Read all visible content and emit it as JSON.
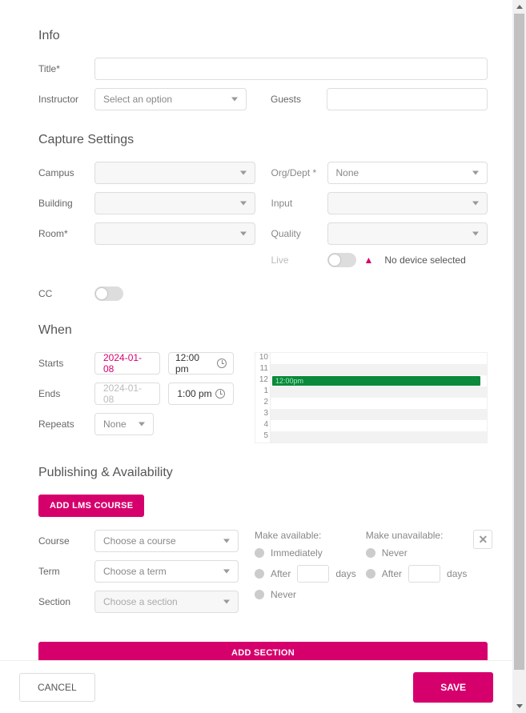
{
  "info": {
    "heading": "Info",
    "title_label": "Title*",
    "instructor_label": "Instructor",
    "instructor_placeholder": "Select an option",
    "guests_label": "Guests"
  },
  "capture": {
    "heading": "Capture Settings",
    "campus_label": "Campus",
    "building_label": "Building",
    "room_label": "Room*",
    "orgdept_label": "Org/Dept *",
    "orgdept_value": "None",
    "input_label": "Input",
    "quality_label": "Quality",
    "live_label": "Live",
    "live_warning": "No device selected",
    "cc_label": "CC"
  },
  "when": {
    "heading": "When",
    "starts_label": "Starts",
    "ends_label": "Ends",
    "repeats_label": "Repeats",
    "repeats_value": "None",
    "start_date": "2024-01-08",
    "start_time": "12:00 pm",
    "end_date": "2024-01-08",
    "end_time": "1:00 pm",
    "timeline_hours": [
      "10",
      "11",
      "12",
      "1",
      "2",
      "3",
      "4",
      "5"
    ],
    "event_label": "12:00pm"
  },
  "publishing": {
    "heading": "Publishing & Availability",
    "add_lms_btn": "ADD LMS COURSE",
    "course_label": "Course",
    "course_placeholder": "Choose a course",
    "term_label": "Term",
    "term_placeholder": "Choose a term",
    "section_label": "Section",
    "section_placeholder": "Choose a section",
    "make_available": "Make available:",
    "make_unavailable": "Make unavailable:",
    "opt_immediately": "Immediately",
    "opt_after": "After",
    "opt_days": "days",
    "opt_never": "Never",
    "add_section_btn": "ADD SECTION"
  },
  "footer": {
    "cancel": "CANCEL",
    "save": "SAVE"
  }
}
